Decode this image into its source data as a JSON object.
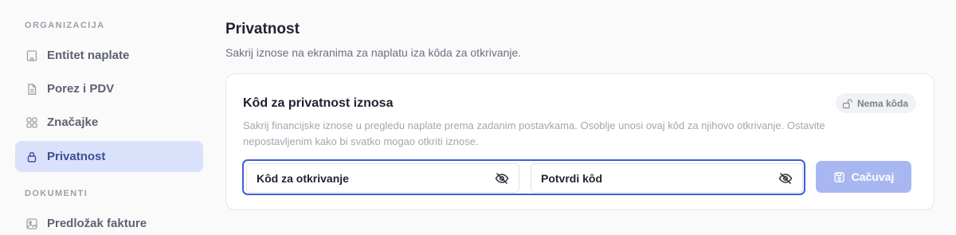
{
  "sidebar": {
    "sections": [
      {
        "label": "ORGANIZACIJA",
        "items": [
          {
            "label": "Entitet naplate",
            "icon": "building-icon"
          },
          {
            "label": "Porez i PDV",
            "icon": "document-icon"
          },
          {
            "label": "Značajke",
            "icon": "grid-icon"
          },
          {
            "label": "Privatnost",
            "icon": "lock-icon",
            "active": true
          }
        ]
      },
      {
        "label": "DOKUMENTI",
        "items": [
          {
            "label": "Predložak fakture",
            "icon": "image-icon"
          }
        ]
      }
    ]
  },
  "main": {
    "title": "Privatnost",
    "subtitle": "Sakrij iznose na ekranima za naplatu iza kôda za otkrivanje.",
    "card": {
      "title": "Kôd za privatnost iznosa",
      "badge": "Nema kôda",
      "description": "Sakrij financijske iznose u pregledu naplate prema zadanim postavkama. Osoblje unosi ovaj kôd za njihovo otkrivanje. Ostavite nepostavljenim kako bi svatko mogao otkriti iznose.",
      "reveal_code_placeholder": "Kôd za otkrivanje",
      "confirm_code_placeholder": "Potvrdi kôd",
      "save_label": "Сačuvaj"
    }
  },
  "colors": {
    "accent": "#3f5fd3",
    "active_nav_bg": "#d9e1fb",
    "save_button_bg": "#a8b7f2"
  }
}
